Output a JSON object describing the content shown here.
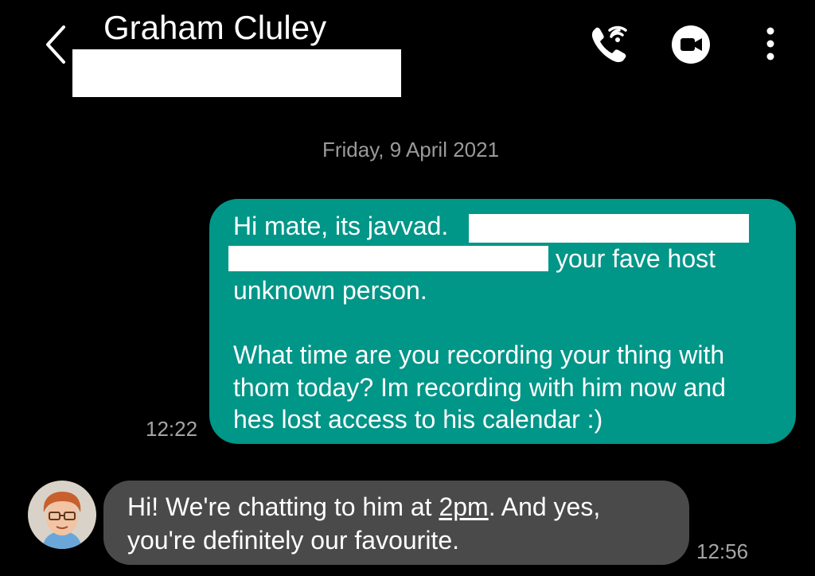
{
  "header": {
    "contact_name": "Graham Cluley",
    "icons": {
      "back": "chevron-left-icon",
      "call": "wifi-call-icon",
      "video": "video-call-icon",
      "more": "more-vertical-icon"
    }
  },
  "conversation": {
    "date_separator": "Friday, 9 April 2021",
    "messages": [
      {
        "direction": "outgoing",
        "lines": [
          "Hi mate, its javvad.",
          "your fave host",
          "unknown person.",
          "",
          "What time are you recording your thing with",
          "thom today? Im recording with him now and",
          "hes lost access to his calendar :)"
        ],
        "time": "12:22"
      },
      {
        "direction": "incoming",
        "line1_before": "Hi! We're chatting to him at ",
        "line1_link": "2pm",
        "line1_after": ". And yes,",
        "line2": "you're definitely our favourite.",
        "time": "12:56"
      }
    ]
  },
  "colors": {
    "background": "#000000",
    "outgoing_bubble": "#009688",
    "incoming_bubble": "#4a4a4a",
    "meta_text": "#9a9a9a"
  }
}
